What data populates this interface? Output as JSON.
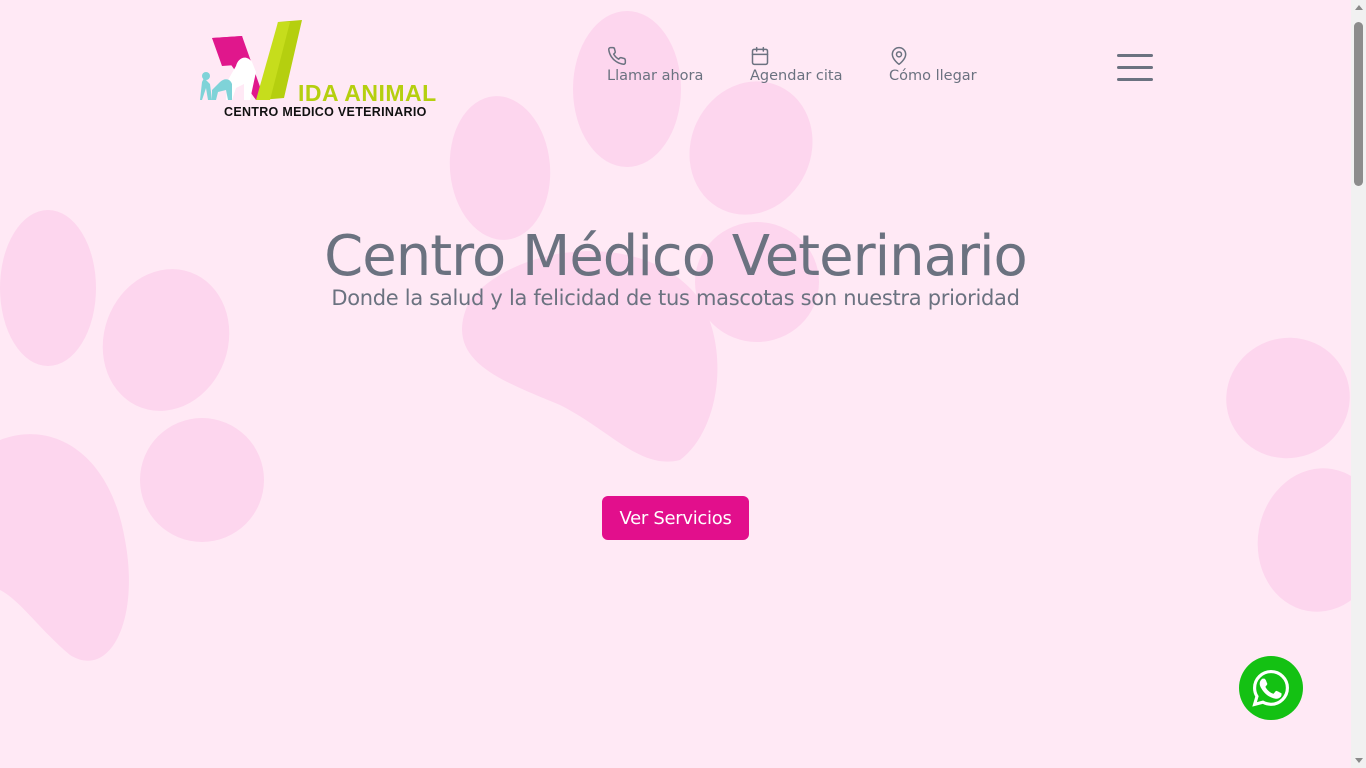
{
  "brand": {
    "name": "IDA ANIMAL",
    "subtitle": "CENTRO MEDICO VETERINARIO",
    "colors": {
      "magenta": "#e0178c",
      "lime": "#b5cf0f",
      "cyan": "#7fd3d8"
    }
  },
  "nav": {
    "items": [
      {
        "label": "Llamar ahora",
        "icon": "phone-icon"
      },
      {
        "label": "Agendar cita",
        "icon": "calendar-icon"
      },
      {
        "label": "Cómo llegar",
        "icon": "map-pin-icon"
      }
    ],
    "menu_icon": "hamburger-menu-icon"
  },
  "hero": {
    "title": "Centro Médico Veterinario",
    "subtitle": "Donde la salud y la felicidad de tus mascotas son nuestra prioridad",
    "cta_label": "Ver Servicios"
  },
  "floating": {
    "whatsapp_icon": "whatsapp-icon"
  },
  "theme": {
    "background": "#ffe9f5",
    "paw_color": "#fdd6ee",
    "accent": "#e20f8c",
    "text": "#6b7280",
    "whatsapp": "#14c113"
  }
}
